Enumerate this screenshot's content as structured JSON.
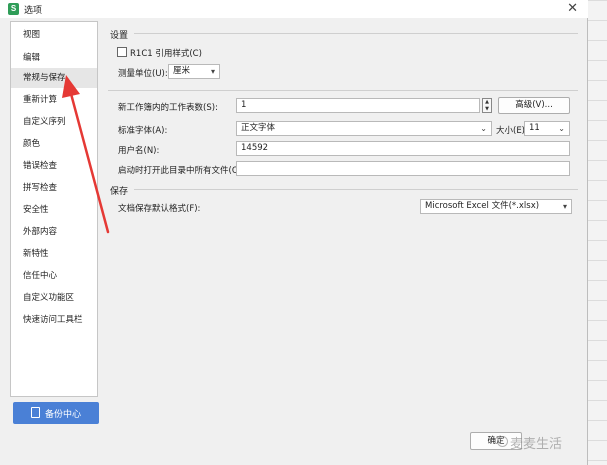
{
  "window": {
    "title": "选项",
    "app_icon_letter": "S",
    "close_glyph": "✕"
  },
  "sidebar": {
    "items": [
      {
        "label": "视图"
      },
      {
        "label": "编辑"
      },
      {
        "label": "常规与保存",
        "selected": true
      },
      {
        "label": "重新计算"
      },
      {
        "label": "自定义序列"
      },
      {
        "label": "颜色"
      },
      {
        "label": "错误检查"
      },
      {
        "label": "拼写检查"
      },
      {
        "label": "安全性"
      },
      {
        "label": "外部内容"
      },
      {
        "label": "新特性"
      },
      {
        "label": "信任中心"
      },
      {
        "label": "自定义功能区"
      },
      {
        "label": "快速访问工具栏"
      }
    ],
    "backup_button": "备份中心"
  },
  "settings": {
    "title": "设置",
    "r1c1_label": "R1C1 引用样式(C)",
    "unit_label": "测量单位(U):",
    "unit_value": "厘米"
  },
  "general": {
    "sheets_label": "新工作簿内的工作表数(S):",
    "sheets_value": "1",
    "advanced_button": "高级(V)...",
    "font_label": "标准字体(A):",
    "font_value": "正文字体",
    "size_label": "大小(E):",
    "size_value": "11",
    "username_label": "用户名(N):",
    "username_value": "14592",
    "startup_label": "启动时打开此目录中所有文件(O):",
    "startup_value": ""
  },
  "save": {
    "title": "保存",
    "format_label": "文档保存默认格式(F):",
    "format_value": "Microsoft Excel 文件(*.xlsx)"
  },
  "footer": {
    "ok_button": "确定"
  },
  "watermark": "麦麦生活",
  "colors": {
    "accent": "#4a80d6",
    "annotation_arrow": "#e53935"
  }
}
